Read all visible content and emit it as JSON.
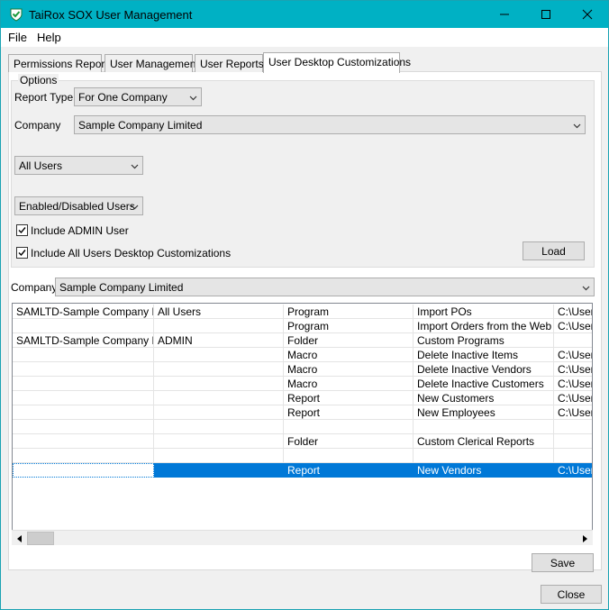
{
  "window": {
    "title": "TaiRox SOX User Management",
    "minimize": "—",
    "maximize": "☐",
    "close": "✕"
  },
  "menu": [
    "File",
    "Help"
  ],
  "tabs": [
    {
      "label": "Permissions Report",
      "active": false
    },
    {
      "label": "User Management",
      "active": false
    },
    {
      "label": "User Reports",
      "active": false
    },
    {
      "label": "User Desktop Customizations",
      "active": true
    }
  ],
  "options": {
    "legend": "Options",
    "report_type_label": "Report Type",
    "report_type_value": "For One Company",
    "company_label": "Company",
    "company_value": "Sample Company Limited",
    "users_value": "All Users",
    "enabled_value": "Enabled/Disabled Users",
    "include_admin_label": "Include ADMIN User",
    "include_admin_checked": true,
    "include_all_label": "Include All Users Desktop Customizations",
    "include_all_checked": true,
    "load_label": "Load"
  },
  "company_filter": {
    "label": "Company",
    "value": "Sample Company Limited"
  },
  "grid": {
    "rows": [
      [
        "SAMLTD-Sample Company Limited",
        "All Users",
        "Program",
        "Import POs",
        "C:\\Users"
      ],
      [
        "",
        "",
        "Program",
        "Import Orders from the Web",
        "C:\\Users"
      ],
      [
        "SAMLTD-Sample Company Limited",
        "ADMIN",
        "Folder",
        "Custom Programs",
        ""
      ],
      [
        "",
        "",
        "Macro",
        "Delete Inactive Items",
        "C:\\Users"
      ],
      [
        "",
        "",
        "Macro",
        "Delete Inactive Vendors",
        "C:\\Users"
      ],
      [
        "",
        "",
        "Macro",
        "Delete Inactive Customers",
        "C:\\Users"
      ],
      [
        "",
        "",
        "Report",
        "New Customers",
        "C:\\Users"
      ],
      [
        "",
        "",
        "Report",
        "New Employees",
        "C:\\Users"
      ],
      [
        "",
        "",
        "",
        "",
        ""
      ],
      [
        "",
        "",
        "Folder",
        "Custom Clerical Reports",
        ""
      ],
      [
        "",
        "",
        "",
        "",
        ""
      ],
      [
        "",
        "",
        "Report",
        "New Vendors",
        "C:\\Users"
      ]
    ],
    "selected_row": 11
  },
  "save_label": "Save",
  "close_label": "Close",
  "colors": {
    "titlebar": "#00b1c4",
    "selection": "#0078d7"
  }
}
